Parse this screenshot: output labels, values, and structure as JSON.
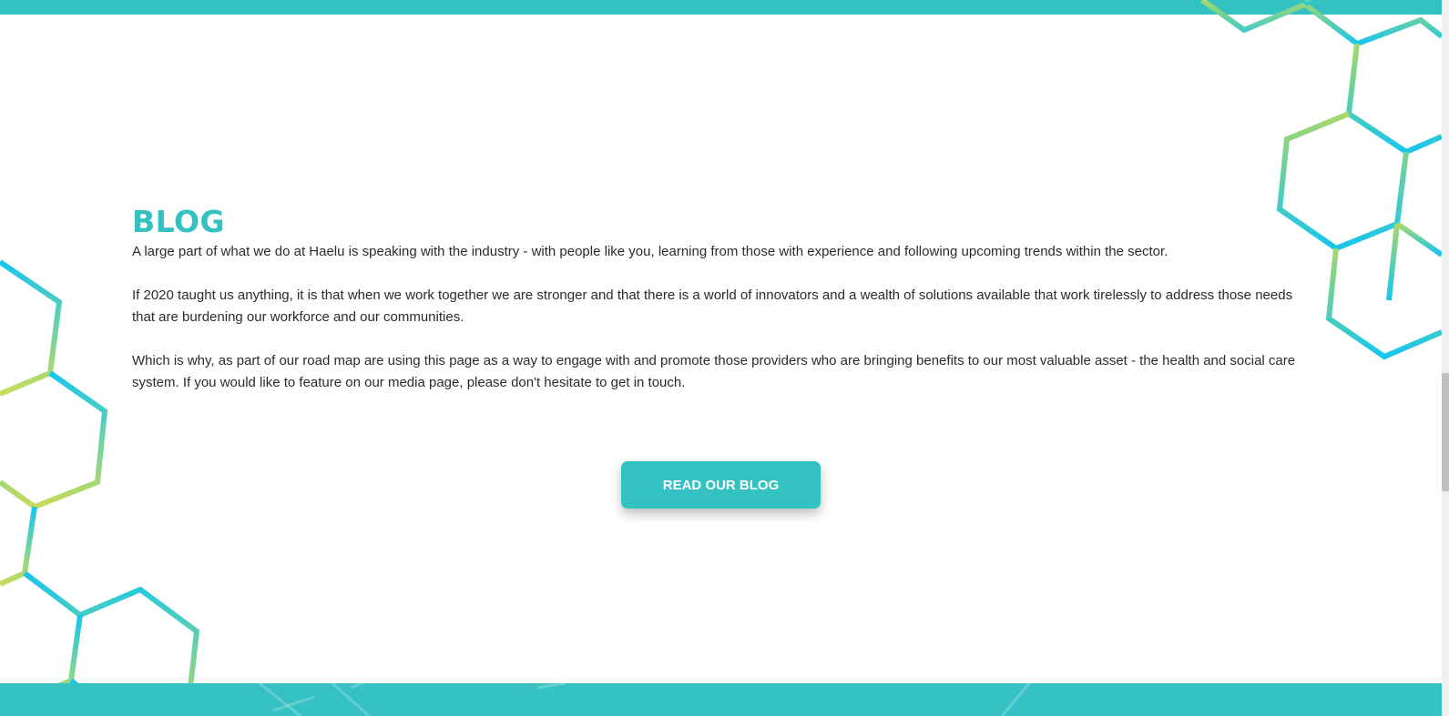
{
  "blog": {
    "title": "BLOG",
    "paragraphs": [
      "A large part of what we do at Haelu is speaking with the industry - with people like you, learning from those with experience and following upcoming trends within the sector.",
      "If 2020 taught us anything, it is that when we work together we are stronger and that there is a world of innovators and a wealth of solutions available that work tirelessly to address those needs that are burdening our workforce and our communities.",
      "Which is why, as part of our road map are using this page as a way to engage with and promote those providers who are bringing benefits to our most valuable asset - the health and social care system. If you would like to feature on our media page, please don't hesitate to get in touch."
    ],
    "button_label": "READ OUR BLOG"
  },
  "colors": {
    "accent": "#33c1c1",
    "hex_top": "#a6d86a",
    "hex_bottom": "#16c6ee"
  }
}
